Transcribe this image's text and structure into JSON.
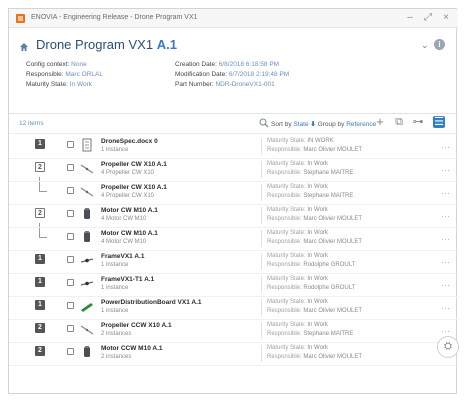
{
  "window": {
    "title": "ENOVIA - Engineering Release - Drone Program VX1"
  },
  "header": {
    "title": "Drone Program VX1",
    "revision": "A.1",
    "meta_left": [
      {
        "key": "Config context:",
        "value": "None"
      },
      {
        "key": "Responsible:",
        "value": "Marc ORLAL"
      },
      {
        "key": "Maturity State:",
        "value": "In Work"
      }
    ],
    "meta_right": [
      {
        "key": "Creation Date:",
        "value": "6/8/2018 6:18:58 PM"
      },
      {
        "key": "Modification Date:",
        "value": "6/7/2018 2:19:48 PM"
      },
      {
        "key": "Part Number:",
        "value": "NDR-DroneVX1-001"
      }
    ]
  },
  "toolbar": {
    "items_count": "12 items",
    "sort_prefix": "Sort by",
    "sort_field": "State",
    "group_prefix": "Group by",
    "group_field": "Reference"
  },
  "rows": [
    {
      "level": "1",
      "outline": false,
      "name": "DroneSpec.docx 0",
      "sub": "1 instance",
      "state_label": "Maturity State:",
      "state": "IN WORK",
      "resp_label": "Responsible:",
      "resp": "Marc Olivier MOULET",
      "thumb": "document-icon"
    },
    {
      "level": "2",
      "outline": true,
      "name": "Propeller CW X10 A.1",
      "sub": "4 Propeller CW X10",
      "state_label": "Maturity State:",
      "state": "In Work",
      "resp_label": "Responsible:",
      "resp": "Stephane MAITRE",
      "thumb": "propeller-icon"
    },
    {
      "level": "",
      "outline": false,
      "name": "Propeller CW X10 A.1",
      "sub": "4 Propeller CW X10",
      "state_label": "Maturity State:",
      "state": "In Work",
      "resp_label": "Responsible:",
      "resp": "Stephane MAITRE",
      "thumb": "propeller-icon"
    },
    {
      "level": "2",
      "outline": true,
      "name": "Motor CW M10 A.1",
      "sub": "4 Motor CW M10",
      "state_label": "Maturity State:",
      "state": "In Work",
      "resp_label": "Responsible:",
      "resp": "Marc Olivier MOULET",
      "thumb": "motor-icon"
    },
    {
      "level": "",
      "outline": false,
      "name": "Motor CW M10 A.1",
      "sub": "4 Motor CW M10",
      "state_label": "Maturity State:",
      "state": "In Work",
      "resp_label": "Responsible:",
      "resp": "Marc Olivier MOULET",
      "thumb": "motor-icon"
    },
    {
      "level": "1",
      "outline": false,
      "name": "FrameVX1 A.1",
      "sub": "1 instance",
      "state_label": "Maturity State:",
      "state": "In Work",
      "resp_label": "Responsible:",
      "resp": "Rodolphe GROULT",
      "thumb": "frame-icon"
    },
    {
      "level": "1",
      "outline": false,
      "name": "FrameVX1-T1 A.1",
      "sub": "1 instance",
      "state_label": "Maturity State:",
      "state": "In Work",
      "resp_label": "Responsible:",
      "resp": "Rodolphe GROULT",
      "thumb": "frame-icon"
    },
    {
      "level": "1",
      "outline": false,
      "name": "PowerDistributionBoard VX1 A.1",
      "sub": "1 instance",
      "state_label": "Maturity State:",
      "state": "In Work",
      "resp_label": "Responsible:",
      "resp": "Marc Olivier MOULET",
      "thumb": "board-icon"
    },
    {
      "level": "2",
      "outline": false,
      "name": "Propeller CCW X10 A.1",
      "sub": "2 instances",
      "state_label": "Maturity State:",
      "state": "In Work",
      "resp_label": "Responsible:",
      "resp": "Stephane MAITRE",
      "thumb": "propeller-icon"
    },
    {
      "level": "2",
      "outline": false,
      "name": "Motor CCW M10 A.1",
      "sub": "2 instances",
      "state_label": "Maturity State:",
      "state": "In Work",
      "resp_label": "Responsible:",
      "resp": "Marc Olivier MOULET",
      "thumb": "motor-icon"
    }
  ]
}
